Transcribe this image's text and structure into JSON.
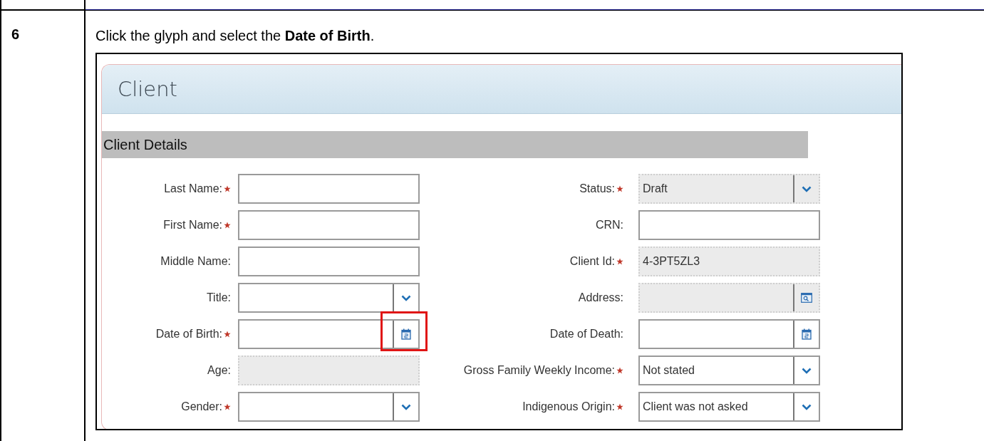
{
  "step": {
    "number": "6",
    "instruction": "Click the glyph and select the **Date of Birth**."
  },
  "screenshot": {
    "panel_title": "Client",
    "section_title": "Client Details",
    "left_fields": [
      {
        "label": "Last Name:",
        "kind": "text",
        "required": true,
        "disabled": false,
        "highlighted": false
      },
      {
        "label": "First Name:",
        "kind": "text",
        "required": true,
        "disabled": false,
        "highlighted": false
      },
      {
        "label": "Middle Name:",
        "kind": "text",
        "required": false,
        "disabled": false,
        "highlighted": false
      },
      {
        "label": "Title:",
        "kind": "select",
        "required": false,
        "disabled": false,
        "highlighted": false
      },
      {
        "label": "Date of Birth:",
        "kind": "date",
        "required": true,
        "disabled": false,
        "highlighted": true
      },
      {
        "label": "Age:",
        "kind": "text",
        "required": false,
        "disabled": true,
        "highlighted": false
      },
      {
        "label": "Gender:",
        "kind": "select",
        "required": true,
        "disabled": false,
        "highlighted": false
      }
    ],
    "right_fields": [
      {
        "label": "Status:",
        "kind": "select",
        "required": true,
        "disabled": true,
        "value": "Draft",
        "highlighted": false
      },
      {
        "label": "CRN:",
        "kind": "text",
        "required": false,
        "disabled": false,
        "highlighted": false
      },
      {
        "label": "Client Id:",
        "kind": "text",
        "required": true,
        "disabled": true,
        "value": "4-3PT5ZL3",
        "highlighted": false
      },
      {
        "label": "Address:",
        "kind": "lookup",
        "required": false,
        "disabled": true,
        "highlighted": false
      },
      {
        "label": "Date of Death:",
        "kind": "date",
        "required": false,
        "disabled": false,
        "highlighted": false
      },
      {
        "label": "Gross Family Weekly Income:",
        "kind": "select",
        "required": true,
        "disabled": false,
        "value": "Not stated",
        "highlighted": false
      },
      {
        "label": "Indigenous Origin:",
        "kind": "select",
        "required": true,
        "disabled": false,
        "value": "Client was not asked",
        "highlighted": false
      }
    ]
  }
}
